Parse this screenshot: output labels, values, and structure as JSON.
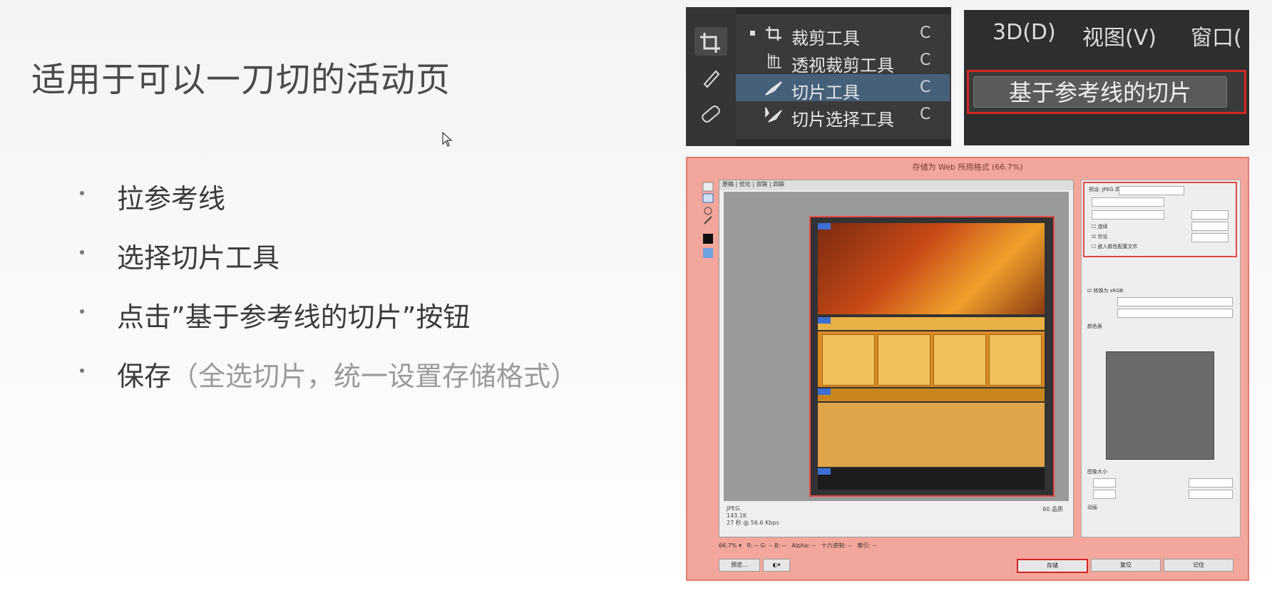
{
  "slide": {
    "title": "适用于可以一刀切的活动页",
    "bullets": [
      {
        "text": "拉参考线",
        "note": ""
      },
      {
        "text": "选择切片工具",
        "note": ""
      },
      {
        "text": "点击”基于参考线的切片”按钮",
        "note": ""
      },
      {
        "text": "保存",
        "note": "（全选切片，统一设置存储格式）"
      }
    ]
  },
  "tools_menu": {
    "items": [
      {
        "label": "裁剪工具",
        "key": "C",
        "icon": "crop-icon",
        "selected": false,
        "active_bullet": true
      },
      {
        "label": "透视裁剪工具",
        "key": "C",
        "icon": "perspective-crop-icon",
        "selected": false,
        "active_bullet": false
      },
      {
        "label": "切片工具",
        "key": "C",
        "icon": "slice-icon",
        "selected": true,
        "active_bullet": false
      },
      {
        "label": "切片选择工具",
        "key": "C",
        "icon": "slice-select-icon",
        "selected": false,
        "active_bullet": false
      }
    ]
  },
  "menubar": {
    "items": [
      "3D(D)",
      "视图(V)",
      "窗口("
    ],
    "slice_button": "基于参考线的切片"
  },
  "dialog": {
    "title": "存储为 Web 所用格式 (66.7%)",
    "buttons": {
      "save": "存储",
      "reset": "复位",
      "done": "记住",
      "preview": "预览..."
    },
    "colors": {
      "accent": "#d32525",
      "dialog_bg": "#f3a69b"
    }
  }
}
